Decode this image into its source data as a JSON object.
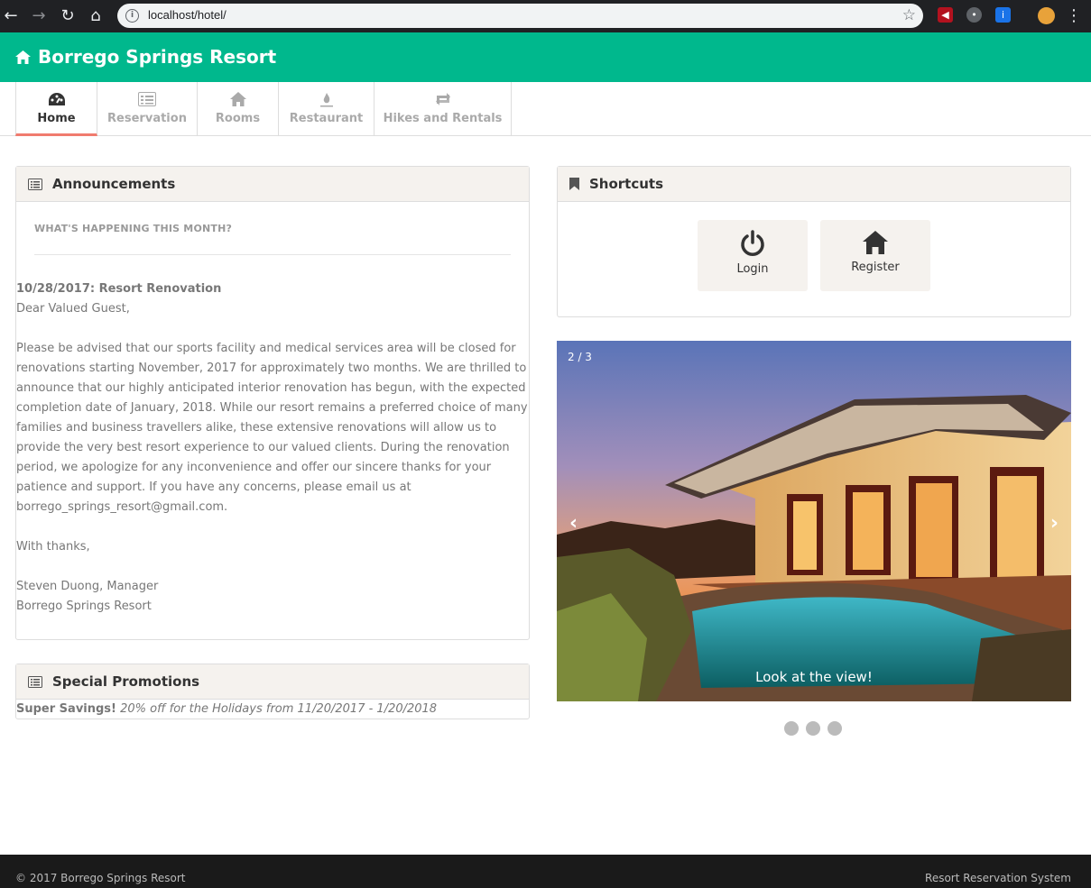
{
  "browser": {
    "url": "localhost/hotel/",
    "back_icon": "back-arrow-icon",
    "forward_icon": "forward-arrow-icon",
    "reload_icon": "reload-icon",
    "home_icon": "home-icon"
  },
  "header": {
    "brand": "Borrego Springs Resort",
    "color": "#00b88d"
  },
  "tabs": [
    {
      "label": "Home",
      "icon": "dashboard-icon",
      "active": true
    },
    {
      "label": "Reservation",
      "icon": "list-icon",
      "active": false
    },
    {
      "label": "Rooms",
      "icon": "home-icon",
      "active": false
    },
    {
      "label": "Restaurant",
      "icon": "fire-icon",
      "active": false
    },
    {
      "label": "Hikes and Rentals",
      "icon": "retweet-icon",
      "active": false
    }
  ],
  "announcements": {
    "title": "Announcements",
    "subtitle": "WHAT'S HAPPENING THIS MONTH?",
    "headline": "10/28/2017: Resort Renovation",
    "greeting": "Dear Valued Guest,",
    "body": "Please be advised that our sports facility and medical services area will be closed for renovations starting November, 2017 for approximately two months. We are thrilled to announce that our highly anticipated interior renovation has begun, with the expected completion date of January, 2018. While our resort remains a preferred choice of many families and business travellers alike, these extensive renovations will allow us to provide the very best resort experience to our valued clients. During the renovation period, we apologize for any inconvenience and offer our sincere thanks for your patience and support. If you have any concerns, please email us at borrego_springs_resort@gmail.com.",
    "closing": "With thanks,",
    "signature_name": "Steven Duong, Manager",
    "signature_org": "Borrego Springs Resort"
  },
  "promotions": {
    "title": "Special Promotions",
    "bold": "Super Savings!",
    "text": "20% off for the Holidays from 11/20/2017 - 1/20/2018"
  },
  "shortcuts": {
    "title": "Shortcuts",
    "login": {
      "label": "Login",
      "icon": "power-icon"
    },
    "register": {
      "label": "Register",
      "icon": "home-icon"
    }
  },
  "carousel": {
    "counter": "2 / 3",
    "caption": "Look at the view!",
    "prev": "‹",
    "next": "›",
    "slides": 3,
    "current": 2
  },
  "footer": {
    "copyright": "© 2017 Borrego Springs Resort",
    "system": "Resort Reservation System"
  },
  "colors": {
    "brand": "#00b88d",
    "active_tab": "#f07b6e",
    "panel_head": "#f5f2ee",
    "footer": "#1a1a1a"
  }
}
